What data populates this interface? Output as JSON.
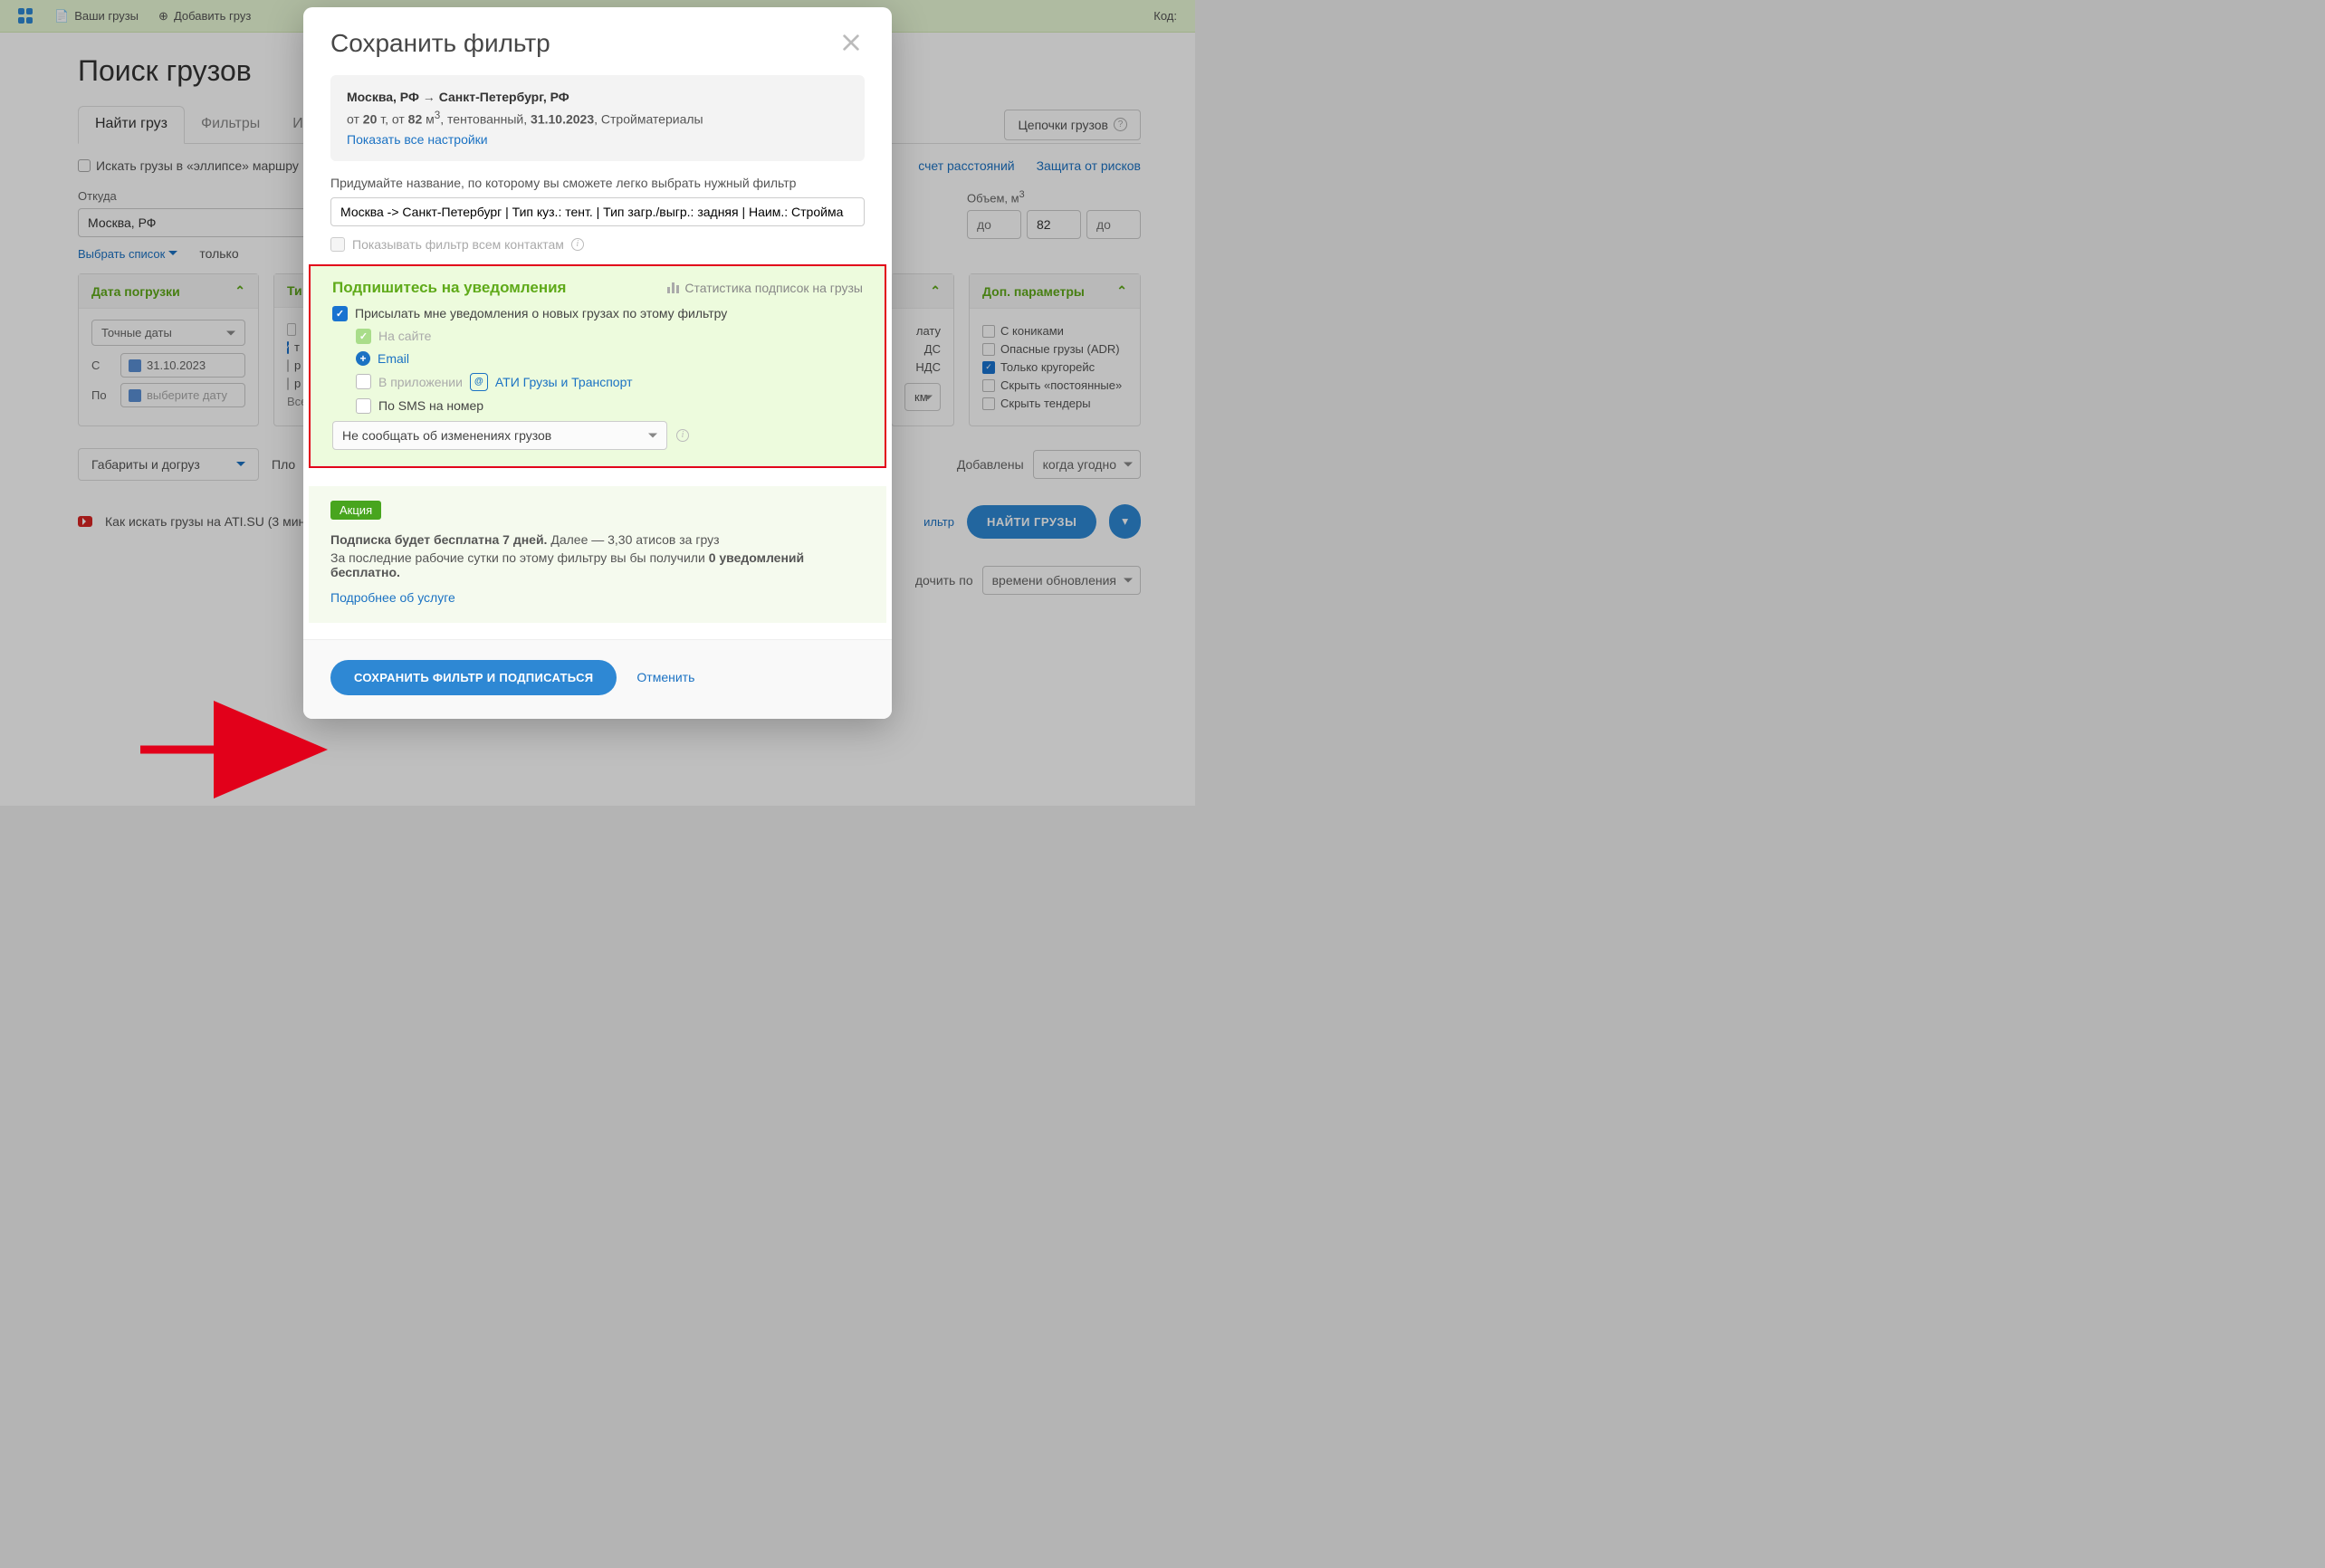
{
  "topbar": {
    "your_cargo": "Ваши грузы",
    "add_cargo": "Добавить груз",
    "code_label": "Код:"
  },
  "page": {
    "title": "Поиск грузов",
    "tab_find": "Найти груз",
    "tab_filters": "Фильтры",
    "chain_btn": "Цепочки грузов",
    "ellipse_cb": "Искать грузы в «эллипсе» маршру",
    "link_distance": "счет расстояний",
    "link_risk": "Защита от рисков",
    "from_label": "Откуда",
    "from_value": "Москва, РФ",
    "select_list": "Выбрать список",
    "only_cb": "только",
    "volume_label": "Объем, м",
    "volume_sup": "3",
    "vol_from": "82",
    "vol_to": "до",
    "panel_date_title": "Дата погрузки",
    "exact_dates": "Точные даты",
    "date_c_lbl": "С",
    "date_c_val": "31.10.2023",
    "date_po_lbl": "По",
    "date_po_ph": "выберите дату",
    "panel_type_title": "Ти",
    "panel_dop_title": "Доп. параметры",
    "dop_opts": [
      "С кониками",
      "Опасные грузы (ADR)",
      "Только кругорейс",
      "Скрыть «постоянные»",
      "Скрыть тендеры"
    ],
    "pay_opts": [
      "лату",
      "ДС",
      "НДС"
    ],
    "km_sel": "км",
    "gabarit": "Габариты и догруз",
    "plo": "Пло",
    "added_lbl": "Добавлены",
    "added_val": "когда угодно",
    "howto": "Как искать грузы на ATI.SU (3 мин)",
    "filter_link": "ильтр",
    "btn_find": "НАЙТИ ГРУЗЫ",
    "sort_lbl": "дочить по",
    "sort_val": "времени обновления"
  },
  "modal": {
    "title": "Сохранить фильтр",
    "summary": {
      "route_from": "Москва, РФ",
      "route_to": "Санкт-Петербург, РФ",
      "meta_prefix_ot1": "от ",
      "weight": "20",
      "weight_unit": " т, ",
      "meta_prefix_ot2": "от ",
      "vol": "82",
      "vol_unit": " м",
      "vol_sup": "3",
      "body": ", тентованный, ",
      "date": "31.10.2023",
      "cargo": ", Стройматериалы",
      "show_all": "Показать все настройки"
    },
    "name_prompt": "Придумайте название, по которому вы сможете легко выбрать нужный фильтр",
    "name_value": "Москва -> Санкт-Петербург | Тип куз.: тент. | Тип загр./выгр.: задняя | Наим.: Стройма",
    "share_label": "Показывать фильтр всем контактам",
    "notif": {
      "title": "Подпишитесь на уведомления",
      "stat": "Статистика подписок на грузы",
      "main_cb": "Присылать мне уведомления о новых грузах по этому фильтру",
      "on_site": "На сайте",
      "email": "Email",
      "in_app": "В приложении",
      "app_name": "АТИ Грузы и Транспорт",
      "by_sms": "По SMS на номер",
      "sel_value": "Не сообщать об изменениях грузов"
    },
    "promo": {
      "badge": "Акция",
      "line1a": "Подписка будет бесплатна 7 дней.",
      "line1b": " Далее — 3,30 атисов за груз",
      "line2a": "За последние рабочие сутки по этому фильтру вы бы получили ",
      "line2b": "0 уведомлений бесплатно.",
      "more": "Подробнее об услуге"
    },
    "btn_save": "СОХРАНИТЬ ФИЛЬТР И ПОДПИСАТЬСЯ",
    "btn_cancel": "Отменить"
  }
}
